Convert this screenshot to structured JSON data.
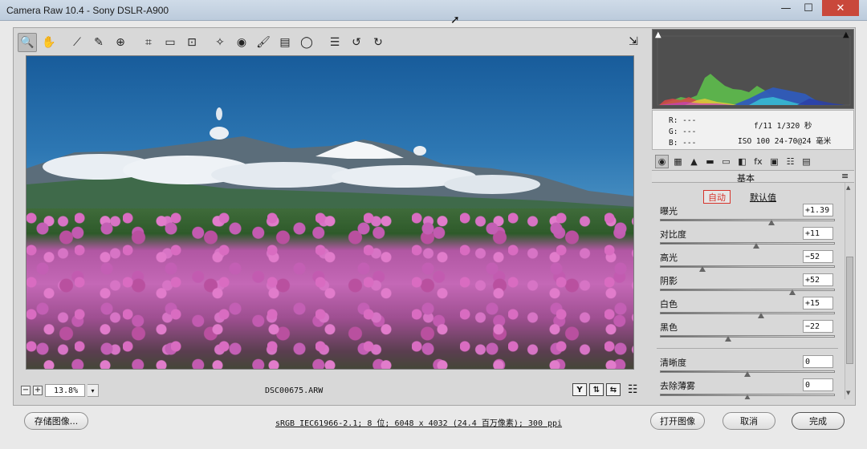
{
  "window": {
    "title": "Camera Raw 10.4 -  Sony DSLR-A900",
    "minimize_glyph": "—",
    "maximize_glyph": "☐",
    "close_glyph": "✕"
  },
  "toolbar": {
    "tools": [
      {
        "name": "zoom-tool-icon",
        "glyph": "🔍"
      },
      {
        "name": "hand-tool-icon",
        "glyph": "✋"
      },
      {
        "name": "white-balance-tool-icon",
        "glyph": "⟋"
      },
      {
        "name": "color-sampler-tool-icon",
        "glyph": "✎"
      },
      {
        "name": "targeted-adjustment-tool-icon",
        "glyph": "⊕"
      },
      {
        "name": "crop-tool-icon",
        "glyph": "⌗"
      },
      {
        "name": "straighten-tool-icon",
        "glyph": "▭"
      },
      {
        "name": "transform-tool-icon",
        "glyph": "⊡"
      },
      {
        "name": "spot-removal-tool-icon",
        "glyph": "✧"
      },
      {
        "name": "red-eye-tool-icon",
        "glyph": "◉"
      },
      {
        "name": "adjustment-brush-icon",
        "glyph": "🖌"
      },
      {
        "name": "graduated-filter-icon",
        "glyph": "▤"
      },
      {
        "name": "radial-filter-icon",
        "glyph": "◯"
      },
      {
        "name": "preferences-icon",
        "glyph": "☰"
      },
      {
        "name": "rotate-left-icon",
        "glyph": "↺"
      },
      {
        "name": "rotate-right-icon",
        "glyph": "↻"
      }
    ],
    "fullscreen_glyph": "⇲"
  },
  "preview": {
    "zoom_out": "−",
    "zoom_in": "+",
    "zoom_level": "13.8%",
    "zoom_dropdown": "▾",
    "filename": "DSC00675.ARW",
    "view_buttons": [
      "Y",
      "⇅",
      "⇆"
    ],
    "view_settings_glyph": "☷"
  },
  "histogram": {
    "shadow_clip_glyph": "▲",
    "highlight_clip_glyph": "▲"
  },
  "info": {
    "r": "R:  ---",
    "g": "G:  ---",
    "b": "B:  ---",
    "aperture_shutter": "f/11  1/320 秒",
    "iso_lens": "ISO 100  24-70@24 毫米"
  },
  "panel": {
    "tabs": [
      "◉",
      "▦",
      "▲",
      "▬",
      "▭",
      "◧",
      "fx",
      "▣",
      "☷",
      "▤"
    ],
    "title": "基本",
    "menu_glyph": "≡",
    "auto_label": "自动",
    "default_label": "默认值",
    "sliders": [
      {
        "label": "曝光",
        "value": "+1.39",
        "level": 0.64
      },
      {
        "label": "对比度",
        "value": "+11",
        "level": 0.55
      },
      {
        "label": "高光",
        "value": "−52",
        "level": 0.24
      },
      {
        "label": "阴影",
        "value": "+52",
        "level": 0.76
      },
      {
        "label": "白色",
        "value": "+15",
        "level": 0.58
      },
      {
        "label": "黑色",
        "value": "−22",
        "level": 0.39
      },
      {
        "label": "清晰度",
        "value": "0",
        "level": 0.5
      },
      {
        "label": "去除薄雾",
        "value": "0",
        "level": 0.5
      }
    ]
  },
  "footer": {
    "save_label": "存储图像...",
    "file_info": "sRGB IEC61966-2.1; 8 位; 6048 x 4032 (24.4 百万像素); 300 ppi",
    "open_label": "打开图像",
    "cancel_label": "取消",
    "done_label": "完成"
  },
  "colors": {
    "auto_border": "#d6332b",
    "title_bar": "#c4d2e1",
    "close_button": "#c9483b"
  }
}
